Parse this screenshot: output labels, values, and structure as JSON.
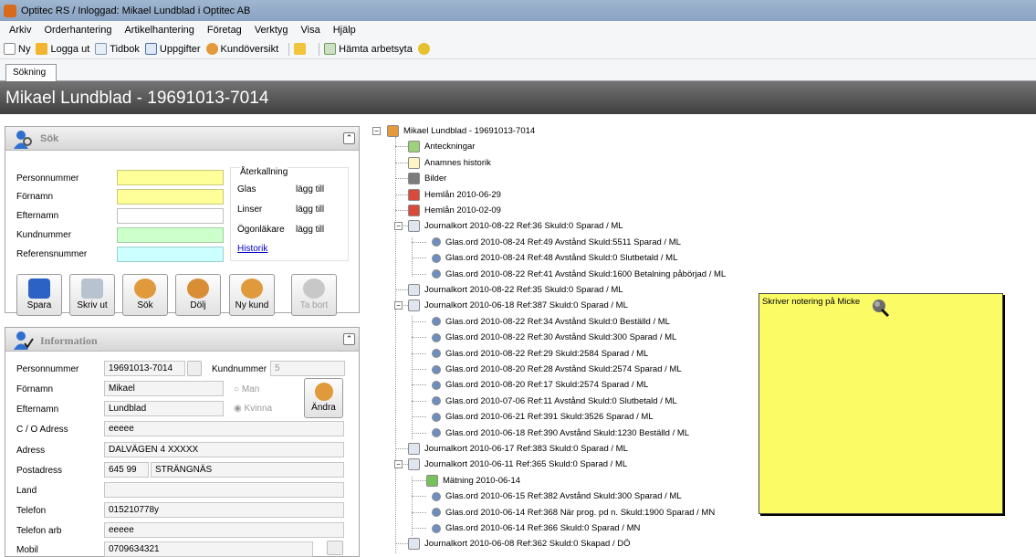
{
  "window": {
    "title": "Optitec RS / Inloggad: Mikael Lundblad i  Optitec AB"
  },
  "menu": [
    "Arkiv",
    "Orderhantering",
    "Artikelhantering",
    "Företag",
    "Verktyg",
    "Visa",
    "Hjälp"
  ],
  "toolbar": {
    "new": "Ny",
    "logout": "Logga ut",
    "timebook": "Tidbok",
    "tasks": "Uppgifter",
    "customer_overview": "Kundöversikt",
    "fetch_workspace": "Hämta arbetsyta"
  },
  "tabs": [
    "Sökning"
  ],
  "header": {
    "title": "Mikael Lundblad - 19691013-7014"
  },
  "search": {
    "title": "Sök",
    "labels": {
      "personnummer": "Personnummer",
      "fornamn": "Förnamn",
      "efternamn": "Efternamn",
      "kundnummer": "Kundnummer",
      "referensnummer": "Referensnummer"
    },
    "recall": {
      "title": "Återkallning",
      "glas": "Glas",
      "linser": "Linser",
      "ogonlakare": "Ögonläkare",
      "add": "lägg till",
      "history": "Historik"
    },
    "buttons": {
      "save": "Spara",
      "print": "Skriv ut",
      "search": "Sök",
      "hide": "Dölj",
      "new_customer": "Ny kund",
      "delete": "Ta bort"
    }
  },
  "info": {
    "title": "Information",
    "labels": {
      "personnummer": "Personnummer",
      "kundnummer": "Kundnummer",
      "fornamn": "Förnamn",
      "efternamn": "Efternamn",
      "co": "C / O Adress",
      "adress": "Adress",
      "postadress": "Postadress",
      "land": "Land",
      "telefon": "Telefon",
      "telefon_arb": "Telefon arb",
      "mobil": "Mobil"
    },
    "values": {
      "personnummer": "19691013-7014",
      "kundnummer": "5",
      "fornamn": "Mikael",
      "efternamn": "Lundblad",
      "co": "eeeee",
      "adress": "DALVÄGEN 4 XXXXX",
      "postnummer": "645 99",
      "ort": "STRÄNGNÄS",
      "land": "",
      "telefon": "015210778y",
      "telefon_arb": "eeeee",
      "mobil": "0709634321"
    },
    "gender": {
      "man": "Man",
      "kvinna": "Kvinna",
      "selected": "Kvinna"
    },
    "edit_button": "Ändra"
  },
  "tree": {
    "root": "Mikael Lundblad - 19691013-7014",
    "nodes": [
      "Anteckningar",
      "Anamnes historik",
      "Bilder",
      "Hemlån  2010-06-29",
      "Hemlån  2010-02-09",
      "Journalkort  2010-08-22 Ref:36 Skuld:0 Sparad / ML",
      "Glas.ord  2010-08-24 Ref:49 Avstånd Skuld:5511 Sparad / ML",
      "Glas.ord  2010-08-24 Ref:48 Avstånd Skuld:0 Slutbetald / ML",
      "Glas.ord  2010-08-22 Ref:41 Avstånd Skuld:1600 Betalning påbörjad / ML",
      "Journalkort  2010-08-22 Ref:35 Skuld:0 Sparad / ML",
      "Journalkort  2010-06-18 Ref:387 Skuld:0 Sparad / ML",
      "Glas.ord  2010-08-22 Ref:34 Avstånd Skuld:0 Beställd / ML",
      "Glas.ord  2010-08-22 Ref:30 Avstånd Skuld:300 Sparad / ML",
      "Glas.ord  2010-08-22 Ref:29  Skuld:2584 Sparad / ML",
      "Glas.ord  2010-08-20 Ref:28 Avstånd Skuld:2574 Sparad / ML",
      "Glas.ord  2010-08-20 Ref:17  Skuld:2574 Sparad / ML",
      "Glas.ord  2010-07-06 Ref:11 Avstånd Skuld:0 Slutbetald / ML",
      "Glas.ord  2010-06-21 Ref:391  Skuld:3526 Sparad / ML",
      "Glas.ord  2010-06-18 Ref:390 Avstånd Skuld:1230 Beställd / ML",
      "Journalkort  2010-06-17 Ref:383 Skuld:0 Sparad / ML",
      "Journalkort  2010-06-11 Ref:365 Skuld:0 Sparad / ML",
      "Mätning  2010-06-14",
      "Glas.ord  2010-06-15 Ref:382 Avstånd Skuld:300 Sparad / ML",
      "Glas.ord  2010-06-14 Ref:368 När prog. pd n. Skuld:1900 Sparad / MN",
      "Glas.ord  2010-06-14 Ref:366  Skuld:0 Sparad / MN",
      "Journalkort  2010-06-08 Ref:362 Skuld:0 Skapad / DÖ"
    ]
  },
  "note": {
    "text": "Skriver notering på Micke"
  },
  "colors": {
    "header_dark": "#3f3f3f",
    "note_yellow": "#fbfb66",
    "field_yellow": "#ffff99",
    "field_green": "#ccffcc",
    "field_cyan": "#ccffff"
  }
}
